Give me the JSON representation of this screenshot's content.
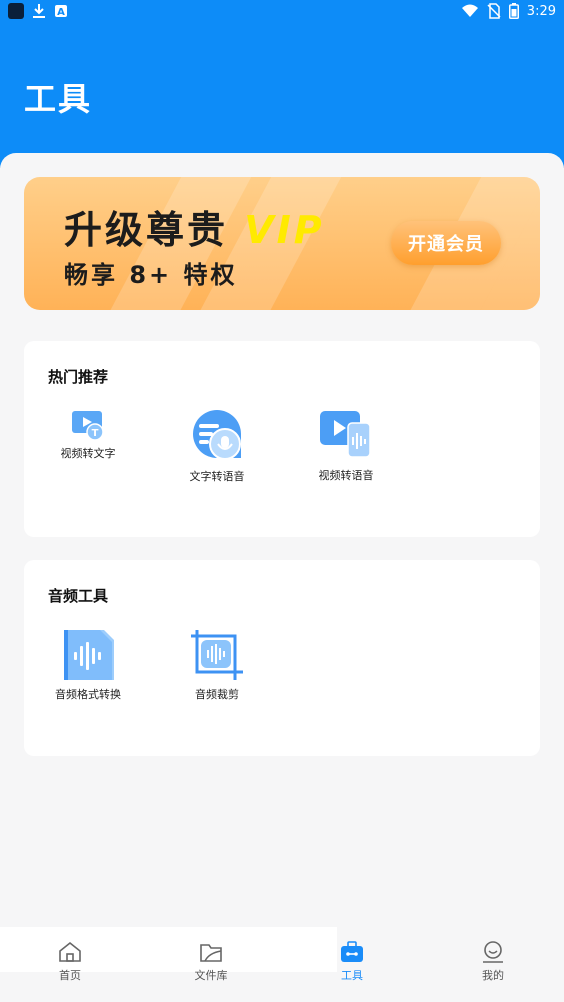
{
  "status_bar": {
    "time": "3:29",
    "icons": [
      "app-icon",
      "download-icon",
      "notification-icon",
      "wifi-icon",
      "no-sim-icon",
      "battery-icon"
    ]
  },
  "page": {
    "title": "工具"
  },
  "vip": {
    "title_cn": "升级尊贵",
    "title_vip": "VIP",
    "subtitle": "畅享 8+ 特权",
    "button": "开通会员"
  },
  "hot": {
    "title": "热门推荐",
    "items": [
      {
        "label": "视频转文字",
        "icon": "video-to-text-icon"
      },
      {
        "label": "文字转语音",
        "icon": "text-to-speech-icon"
      },
      {
        "label": "视频转语音",
        "icon": "video-to-audio-icon"
      }
    ]
  },
  "audio": {
    "title": "音频工具",
    "items": [
      {
        "label": "音频格式转换",
        "icon": "audio-format-icon"
      },
      {
        "label": "音频裁剪",
        "icon": "audio-crop-icon"
      }
    ]
  },
  "nav": {
    "items": [
      {
        "label": "首页",
        "icon": "home-icon",
        "active": false
      },
      {
        "label": "文件库",
        "icon": "folder-icon",
        "active": false
      },
      {
        "label": "工具",
        "icon": "toolbox-icon",
        "active": true
      },
      {
        "label": "我的",
        "icon": "profile-icon",
        "active": false
      }
    ]
  },
  "colors": {
    "primary": "#0d8cf8",
    "nav_active": "#1a8cf8",
    "vip_gold": "#ffb257",
    "vip_text": "#ffea00"
  }
}
